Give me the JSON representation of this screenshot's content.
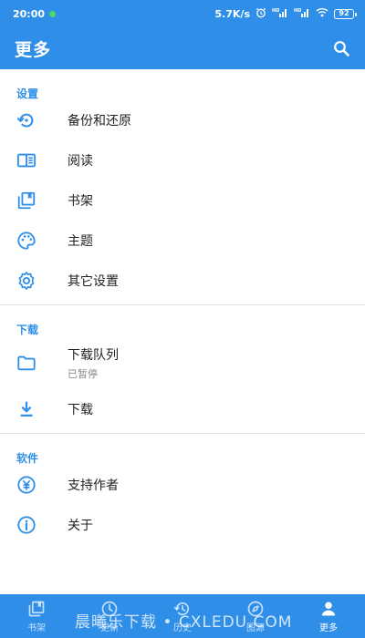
{
  "status_bar": {
    "time": "20:00",
    "network_speed": "5.7K/s",
    "signal_1": "HD",
    "signal_2": "HD",
    "battery": "92"
  },
  "app_bar": {
    "title": "更多",
    "search_icon": "search-icon"
  },
  "sections": [
    {
      "header": "设置",
      "items": [
        {
          "label": "备份和还原",
          "icon": "backup-restore-icon"
        },
        {
          "label": "阅读",
          "icon": "book-open-icon"
        },
        {
          "label": "书架",
          "icon": "library-icon"
        },
        {
          "label": "主题",
          "icon": "palette-icon"
        },
        {
          "label": "其它设置",
          "icon": "gear-icon"
        }
      ]
    },
    {
      "header": "下载",
      "items": [
        {
          "label": "下载队列",
          "sublabel": "已暂停",
          "icon": "folder-icon"
        },
        {
          "label": "下载",
          "icon": "download-icon"
        }
      ]
    },
    {
      "header": "软件",
      "items": [
        {
          "label": "支持作者",
          "icon": "support-icon"
        },
        {
          "label": "关于",
          "icon": "info-icon"
        }
      ]
    }
  ],
  "bottom_nav": [
    {
      "label": "书架",
      "icon": "library-icon",
      "active": false
    },
    {
      "label": "更新",
      "icon": "update-icon",
      "active": false
    },
    {
      "label": "历史",
      "icon": "history-icon",
      "active": false
    },
    {
      "label": "图源",
      "icon": "compass-icon",
      "active": false
    },
    {
      "label": "更多",
      "icon": "person-icon",
      "active": true
    }
  ],
  "watermark": "晨曦乐下载 • CXLEDU.COM",
  "colors": {
    "primary": "#2f8fe8",
    "section_header": "#2f8fe8",
    "divider": "#e2e2e2",
    "background": "#ffffff"
  }
}
